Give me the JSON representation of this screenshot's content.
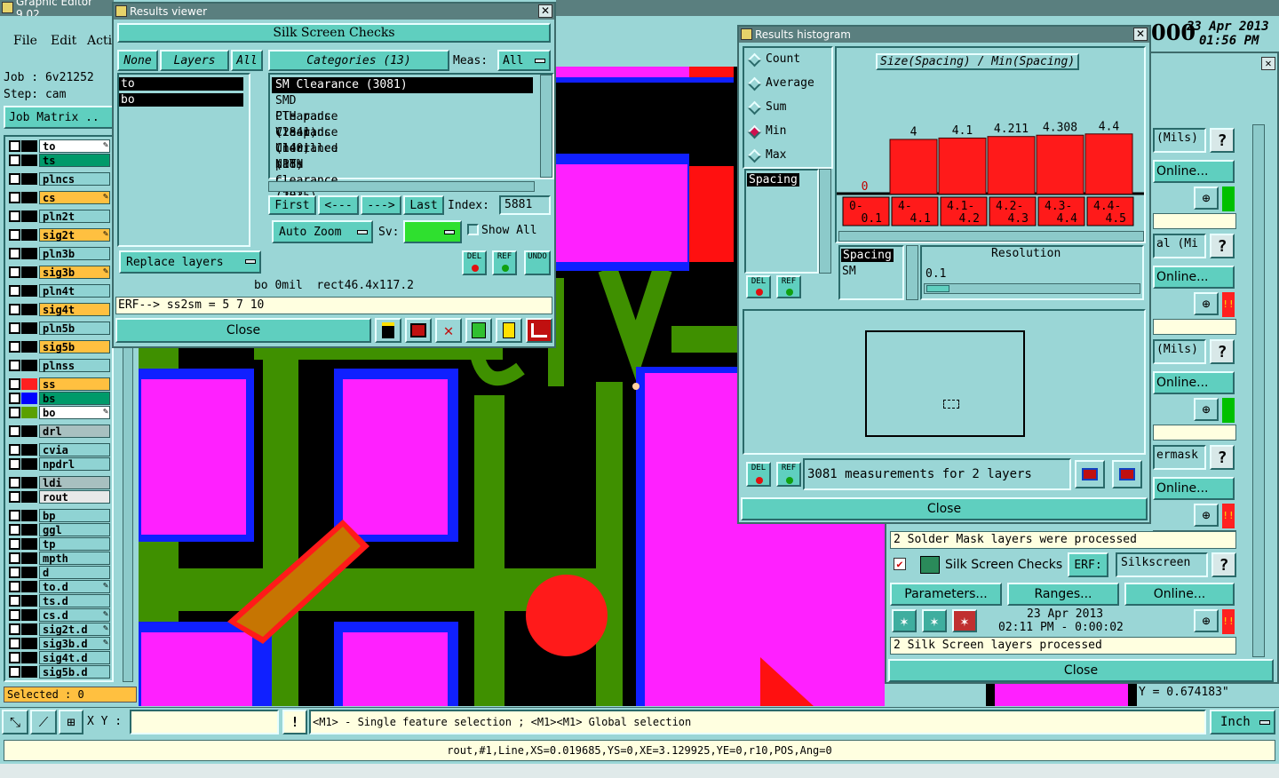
{
  "main": {
    "title": "Graphic Editor 9.02",
    "menu": [
      "File",
      "Edit",
      "Acti"
    ],
    "job_label": "Job : 6v21252",
    "step_label": "Step: cam",
    "job_matrix": "Job Matrix ..",
    "date": "23 Apr 2013",
    "time": "01:56 PM",
    "clock_digits": "000",
    "selected": "Selected : 0",
    "xy_label": "X Y :",
    "xy_value": "",
    "hint": "<M1> - Single feature selection ; <M1><M1> Global selection",
    "status": "rout,#1,Line,XS=0.019685,YS=0,XE=3.129925,YE=0,r10,POS,Ang=0",
    "units": "Inch",
    "y_readout": "Y = 0.674183\""
  },
  "layers": [
    {
      "name": "to",
      "color": "#ffffff",
      "swatch": "#000000",
      "edit": true
    },
    {
      "name": "ts",
      "color": "#009a6a",
      "swatch": "#000000",
      "edit": false
    },
    {
      "name": "plncs",
      "color": "#8fd3d3",
      "swatch": "#000000",
      "edit": false
    },
    {
      "name": "cs",
      "color": "#ffc040",
      "swatch": "#000000",
      "edit": true
    },
    {
      "name": "pln2t",
      "color": "#8fd3d3",
      "swatch": "#000000",
      "edit": false
    },
    {
      "name": "sig2t",
      "color": "#ffc040",
      "swatch": "#000000",
      "edit": true
    },
    {
      "name": "pln3b",
      "color": "#8fd3d3",
      "swatch": "#000000",
      "edit": false
    },
    {
      "name": "sig3b",
      "color": "#ffc040",
      "swatch": "#000000",
      "edit": true
    },
    {
      "name": "pln4t",
      "color": "#8fd3d3",
      "swatch": "#000000",
      "edit": false
    },
    {
      "name": "sig4t",
      "color": "#ffc040",
      "swatch": "#000000",
      "edit": false
    },
    {
      "name": "pln5b",
      "color": "#8fd3d3",
      "swatch": "#000000",
      "edit": false
    },
    {
      "name": "sig5b",
      "color": "#ffc040",
      "swatch": "#000000",
      "edit": false
    },
    {
      "name": "plnss",
      "color": "#8fd3d3",
      "swatch": "#000000",
      "edit": false
    },
    {
      "name": "ss",
      "color": "#ffc040",
      "swatch": "#ff2020",
      "edit": false
    },
    {
      "name": "bs",
      "color": "#009a6a",
      "swatch": "#0000ff",
      "edit": false
    },
    {
      "name": "bo",
      "color": "#ffffff",
      "swatch": "#5aa000",
      "edit": true
    },
    {
      "name": "drl",
      "color": "#a8c0c0",
      "swatch": "#000000",
      "edit": false
    },
    {
      "name": "cvia",
      "color": "#8fd3d3",
      "swatch": "#000000",
      "edit": false
    },
    {
      "name": "npdrl",
      "color": "#8fd3d3",
      "swatch": "#000000",
      "edit": false
    },
    {
      "name": "ldi",
      "color": "#a8c0c0",
      "swatch": "#000000",
      "edit": false
    },
    {
      "name": "rout",
      "color": "#e8e8e8",
      "swatch": "#000000",
      "edit": false
    },
    {
      "name": "bp",
      "color": "#8fd3d3",
      "swatch": "#000000",
      "edit": false
    },
    {
      "name": "ggl",
      "color": "#8fd3d3",
      "swatch": "#000000",
      "edit": false
    },
    {
      "name": "tp",
      "color": "#8fd3d3",
      "swatch": "#000000",
      "edit": false
    },
    {
      "name": "mpth",
      "color": "#8fd3d3",
      "swatch": "#000000",
      "edit": false
    },
    {
      "name": "d",
      "color": "#8fd3d3",
      "swatch": "#000000",
      "edit": false
    },
    {
      "name": "to.d",
      "color": "#8fd3d3",
      "swatch": "#000000",
      "edit": true
    },
    {
      "name": "ts.d",
      "color": "#8fd3d3",
      "swatch": "#000000",
      "edit": false
    },
    {
      "name": "cs.d",
      "color": "#8fd3d3",
      "swatch": "#000000",
      "edit": true
    },
    {
      "name": "sig2t.d",
      "color": "#8fd3d3",
      "swatch": "#000000",
      "edit": true
    },
    {
      "name": "sig3b.d",
      "color": "#8fd3d3",
      "swatch": "#000000",
      "edit": true
    },
    {
      "name": "sig4t.d",
      "color": "#8fd3d3",
      "swatch": "#000000",
      "edit": false
    },
    {
      "name": "sig5b.d",
      "color": "#8fd3d3",
      "swatch": "#000000",
      "edit": false
    }
  ],
  "results_viewer": {
    "title": "Results viewer",
    "header": "Silk Screen Checks",
    "none_btn": "None",
    "layers_btn": "Layers",
    "all_btn": "All",
    "layer_items": [
      "to",
      "bo"
    ],
    "categories_btn": "Categories (13)",
    "meas_label": "Meas:",
    "meas_value": "All",
    "categories": [
      "SM Clearance (3081)",
      "SMD Clearance (2841)",
      "PTH pads Clearance (140)",
      "Via pads Clearance (18)",
      "Undrilled pads Clearance (2835)",
      "NPTH clearance (10)"
    ],
    "first_btn": "First",
    "prev_btn": "<---",
    "next_btn": "--->",
    "last_btn": "Last",
    "index_label": "Index:",
    "index_value": "5881",
    "auto_zoom": "Auto Zoom",
    "sv_label": "Sv:",
    "show_all": "Show All",
    "replace_layers": "Replace layers",
    "del": "DEL",
    "ref": "REF",
    "undo": "UNDO",
    "info_line": "bo 0mil  rect46.4x117.2",
    "erf_line": "ERF--> ss2sm = 5 7 10",
    "close": "Close"
  },
  "histogram": {
    "title": "Results histogram",
    "stat_options": [
      "Count",
      "Average",
      "Sum",
      "Min",
      "Max"
    ],
    "selected_stat": "Min",
    "chart_title": "Size(Spacing) / Min(Spacing)",
    "measure_item": "Spacing",
    "spacing_items": [
      "Spacing",
      "SM"
    ],
    "resolution_label": "Resolution",
    "resolution_value": "0.1",
    "summary": "3081 measurements for 2 layers",
    "del": "DEL",
    "ref": "REF",
    "close": "Close"
  },
  "chart_data": {
    "type": "bar",
    "title": "Size(Spacing) / Min(Spacing)",
    "categories": [
      "0-0.1",
      "4-4.1",
      "4.1-4.2",
      "4.2-4.3",
      "4.3-4.4",
      "4.4-4.5"
    ],
    "category_lines": [
      [
        "0-",
        "0.1"
      ],
      [
        "4-",
        "4.1"
      ],
      [
        "4.1-",
        "4.2"
      ],
      [
        "4.2-",
        "4.3"
      ],
      [
        "4.3-",
        "4.4"
      ],
      [
        "4.4-",
        "4.5"
      ]
    ],
    "values": [
      0,
      4,
      4.1,
      4.211,
      4.308,
      4.4
    ],
    "value_labels": [
      "0",
      "4",
      "4.1",
      "4.211",
      "4.308",
      "4.4"
    ],
    "ylim": [
      0,
      6.5
    ],
    "bar_color": "#ff1a1a"
  },
  "right_panel": {
    "rows": [
      {
        "label": "(Mils)",
        "online": "Online...",
        "status_color": "#00c000"
      },
      {
        "label": "al (Mi",
        "online": "Online...",
        "status_color": "#ff2020"
      },
      {
        "label": "(Mils)",
        "online": "Online...",
        "status_color": "#00c000"
      },
      {
        "label": "ermask",
        "online": "Online...",
        "status_color": "#ff2020"
      }
    ],
    "sm_processed": "2 Solder Mask layers were processed",
    "silk_title": "Silk Screen Checks",
    "erf_label": "ERF:",
    "erf_value": "Silkscreen",
    "parameters": "Parameters...",
    "ranges": "Ranges...",
    "online": "Online...",
    "run_date": "23 Apr 2013",
    "run_time": "02:11 PM - 0:00:02",
    "ss_processed": "2 Silk Screen layers processed",
    "close": "Close",
    "help": "?"
  }
}
